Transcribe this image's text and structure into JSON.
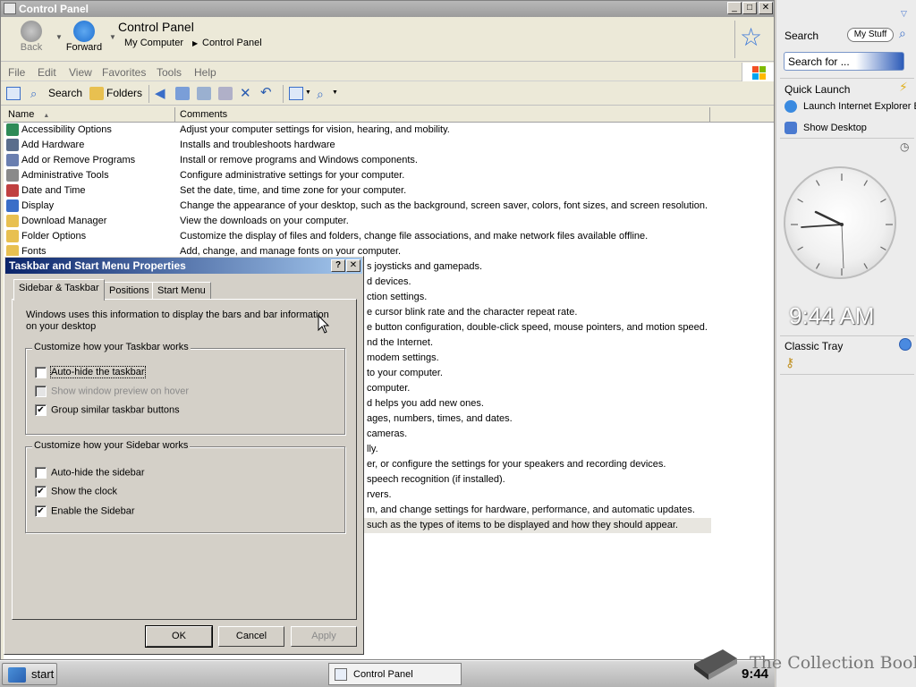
{
  "window": {
    "title": "Control Panel",
    "caption": {
      "minimize": "_",
      "maximize": "□",
      "close": "✕"
    }
  },
  "address": {
    "back_label": "Back",
    "forward_label": "Forward",
    "title": "Control Panel",
    "crumbs": [
      "My Computer",
      "Control Panel"
    ]
  },
  "menubar": {
    "items": [
      "File",
      "Edit",
      "View",
      "Favorites",
      "Tools",
      "Help"
    ]
  },
  "toolbar": {
    "search_label": "Search",
    "folders_label": "Folders"
  },
  "list": {
    "columns": [
      "Name",
      "Comments"
    ],
    "rows": [
      {
        "name": "Accessibility Options",
        "comment": "Adjust your computer settings for vision, hearing, and mobility.",
        "color": "#2e8b57"
      },
      {
        "name": "Add Hardware",
        "comment": "Installs and troubleshoots hardware",
        "color": "#5a6e8c"
      },
      {
        "name": "Add or Remove Programs",
        "comment": "Install or remove programs and Windows components.",
        "color": "#6a7fb0"
      },
      {
        "name": "Administrative Tools",
        "comment": "Configure administrative settings for your computer.",
        "color": "#8a8a8a"
      },
      {
        "name": "Date and Time",
        "comment": "Set the date, time, and time zone for your computer.",
        "color": "#c04040"
      },
      {
        "name": "Display",
        "comment": "Change the appearance of your desktop, such as the background, screen saver, colors, font sizes, and screen resolution.",
        "color": "#3a6ec8"
      },
      {
        "name": "Download Manager",
        "comment": "View the downloads on your computer.",
        "color": "#e8c050"
      },
      {
        "name": "Folder Options",
        "comment": "Customize the display of files and folders, change file associations, and make network files available offline.",
        "color": "#e8c050"
      },
      {
        "name": "Fonts",
        "comment": "Add, change, and manage fonts on your computer.",
        "color": "#e8c050"
      }
    ],
    "partial_comments": [
      "s joysticks and gamepads.",
      "d devices.",
      "ction settings.",
      "e cursor blink rate and the character repeat rate.",
      "e button configuration, double-click speed, mouse pointers, and motion speed.",
      "nd the Internet.",
      "modem settings.",
      "to your computer.",
      "computer.",
      "d helps you add new ones.",
      "ages, numbers, times, and dates.",
      "cameras.",
      "lly.",
      "er, or configure the settings for your speakers and recording devices.",
      "speech recognition (if installed).",
      "rvers.",
      "m, and change settings for hardware, performance, and automatic updates.",
      "such as the types of items to be displayed and how they should appear."
    ]
  },
  "dialog": {
    "title": "Taskbar and Start Menu Properties",
    "help": "?",
    "close": "✕",
    "tabs": [
      "Sidebar & Taskbar",
      "Positions",
      "Start Menu"
    ],
    "description": "Windows uses this information to display the bars and bar information on your desktop",
    "taskbar_group": "Customize how your Taskbar works",
    "taskbar_options": [
      {
        "label": "Auto-hide the taskbar",
        "checked": false,
        "disabled": false
      },
      {
        "label": "Show window preview on hover",
        "checked": false,
        "disabled": true
      },
      {
        "label": "Group similar taskbar buttons",
        "checked": true,
        "disabled": false
      }
    ],
    "sidebar_group": "Customize how your Sidebar works",
    "sidebar_options": [
      {
        "label": "Auto-hide the sidebar",
        "checked": false
      },
      {
        "label": "Show the clock",
        "checked": true
      },
      {
        "label": "Enable the Sidebar",
        "checked": true
      }
    ],
    "buttons": {
      "ok": "OK",
      "cancel": "Cancel",
      "apply": "Apply"
    }
  },
  "sidebar": {
    "search_label": "Search",
    "my_stuff": "My Stuff",
    "search_placeholder": "Search for ...",
    "quick_launch": "Quick Launch",
    "quick_items": [
      "Launch Internet Explorer Browser",
      "Show Desktop"
    ],
    "clock_time": "9:44 AM",
    "classic_tray": "Classic Tray"
  },
  "taskbar": {
    "start": "start",
    "task": "Control Panel",
    "clock": "9:44"
  },
  "watermark": "The Collection Book",
  "colors": {
    "accent": "#3b78d8",
    "dialog_title_start": "#0a246a",
    "dialog_title_end": "#a6caf0"
  }
}
